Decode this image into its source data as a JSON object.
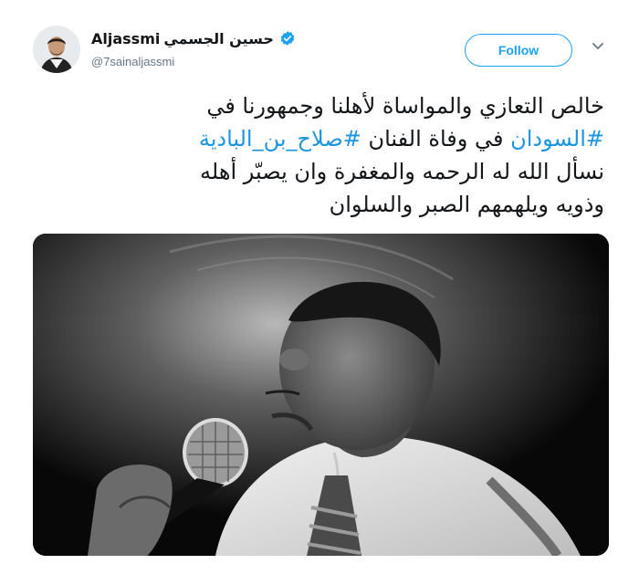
{
  "user": {
    "display_name_latin": "Aljassmi",
    "display_name_arabic": "حسين الجسمي",
    "handle": "@7sainaljassmi",
    "verified_icon": "verified-badge-icon"
  },
  "actions": {
    "follow_label": "Follow",
    "more_icon": "chevron-down-icon"
  },
  "tweet": {
    "line1": "خالص التعازي والمواساة لأهلنا وجمهورنا في",
    "line2_hashtag1": "#السودان",
    "line2_middle": " في وفاة الفنان ",
    "line2_hashtag2": "#صلاح_بن_البادية",
    "line3": "نسأل الله له الرحمه والمغفرة وان يصبّر أهله",
    "line4": "وذويه ويلهمهم الصبر والسلوان"
  },
  "colors": {
    "accent": "#1da1f2",
    "hashtag": "#1b95e0",
    "text": "#14171a",
    "muted": "#657786"
  }
}
